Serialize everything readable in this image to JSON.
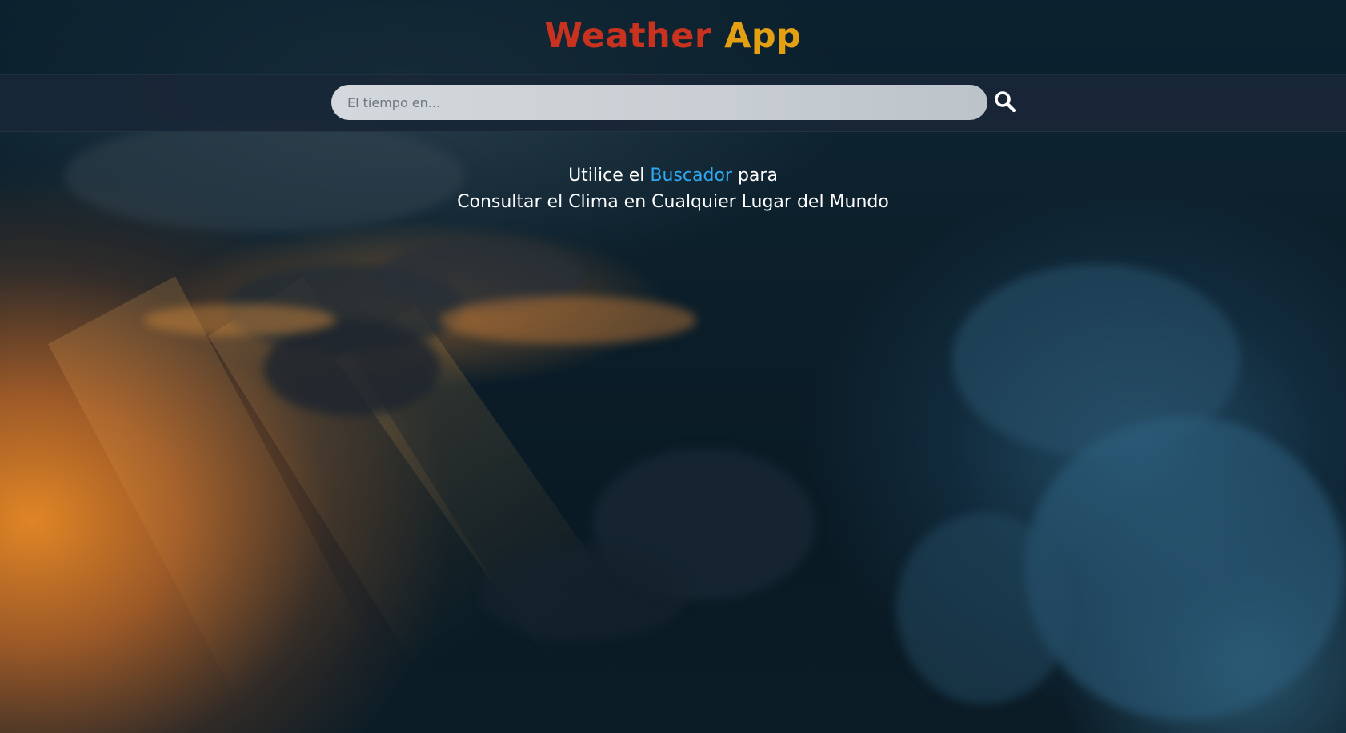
{
  "header": {
    "title_part1": "Weather",
    "title_part2": "App"
  },
  "search": {
    "placeholder": "El tiempo en...",
    "value": "",
    "button_icon": "search-icon"
  },
  "intro": {
    "line1_prefix": "Utilice el",
    "line1_link": "Buscador",
    "line1_suffix": "para",
    "line2": "Consultar el Clima en Cualquier Lugar del Mundo"
  },
  "colors": {
    "title_part1": "#c9321f",
    "title_part2": "#e3a013",
    "accent_link": "#2fa9f0",
    "search_bar_bg": "#182636"
  }
}
